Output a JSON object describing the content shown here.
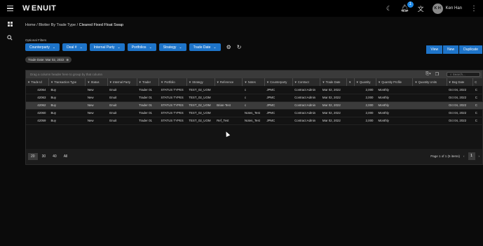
{
  "brand": {
    "logo_mark": "W",
    "name": "ENUIT"
  },
  "topbar": {
    "notification_count": "1",
    "avatar_initials": "K H",
    "user_name": "Ken Han"
  },
  "breadcrumb": {
    "home": "Home",
    "sep1": " / ",
    "level2": "Blotter By Trade Type",
    "sep2": " / ",
    "current": "Cleared Fixed Float Swap"
  },
  "filters": {
    "label": "Optional Filters",
    "buttons": [
      "Counterparty",
      "Deal #",
      "Internal Party",
      "Portfolios",
      "Strategy",
      "Trade Date"
    ]
  },
  "actions": {
    "view": "View",
    "new": "New",
    "duplicate": "Duplicate"
  },
  "chip": {
    "label": "Trade Date: Mar 02, 2022"
  },
  "grid": {
    "group_placeholder": "Drag a column header here to group by that column",
    "search_placeholder": "Search...",
    "columns": [
      "Trade Id",
      "Transaction Type",
      "Status",
      "Internal Party",
      "Trader",
      "Portfolio",
      "Strategy",
      "Reference",
      "Notes",
      "Counterparty",
      "Contract",
      "Trade Date",
      "",
      "Quantity",
      "Quantity Profile",
      "Quantity Units",
      "Beg Date",
      "C"
    ],
    "rows": [
      [
        "42064",
        "Buy",
        "New",
        "Enuit",
        "Trader 01",
        "STATUS TYPES",
        "TEST_02_UOM",
        "",
        "c",
        "JPMC",
        "Contract Admin",
        "Mar 02, 2022",
        "",
        "2,000",
        "Monthly",
        "",
        "Oct 04, 2022",
        "C"
      ],
      [
        "42063",
        "Buy",
        "New",
        "Enuit",
        "Trader 01",
        "STATUS TYPES",
        "TEST_02_UOM",
        "",
        "c",
        "JPMC",
        "Contract Admin",
        "Mar 02, 2022",
        "",
        "2,000",
        "Monthly",
        "",
        "Oct 04, 2022",
        "C"
      ],
      [
        "42062",
        "Buy",
        "New",
        "Enuit",
        "Trader 01",
        "STATUS TYPES",
        "TEST_02_UOM",
        "Brian-Test",
        "c",
        "JPMC",
        "Contract Admin",
        "Mar 02, 2022",
        "",
        "2,000",
        "Monthly",
        "",
        "Oct 04, 2022",
        "C"
      ],
      [
        "42060",
        "Buy",
        "New",
        "Enuit",
        "Trader 01",
        "STATUS TYPES",
        "TEST_02_UOM",
        "",
        "Notes_Test",
        "JPMC",
        "Contract Admin",
        "Mar 02, 2022",
        "",
        "2,000",
        "Monthly",
        "",
        "Oct 04, 2022",
        "C"
      ],
      [
        "42059",
        "Buy",
        "New",
        "Enuit",
        "Trader 01",
        "STATUS TYPES",
        "TEST_02_UOM",
        "Ref_Test",
        "Notes_Test",
        "JPMC",
        "Contract Admin",
        "Mar 02, 2022",
        "",
        "2,000",
        "Monthly",
        "",
        "Oct 04, 2022",
        "C"
      ]
    ],
    "highlighted_row": 2
  },
  "footer": {
    "page_sizes": [
      "20",
      "30",
      "40",
      "All"
    ],
    "selected_page_size": "20",
    "summary": "Page 1 of 1 (5 items)",
    "current_page": "1"
  }
}
